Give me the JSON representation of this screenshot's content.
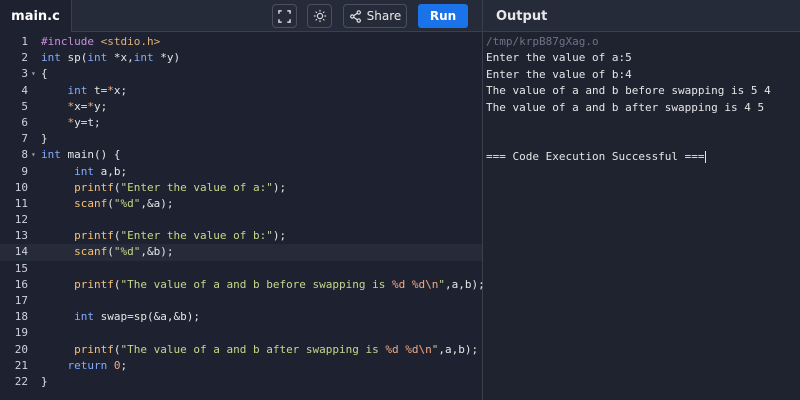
{
  "editor": {
    "file_tab": "main.c",
    "share_label": "Share",
    "run_label": "Run",
    "lines": [
      {
        "num": "1",
        "fold": ""
      },
      {
        "num": "2",
        "fold": ""
      },
      {
        "num": "3",
        "fold": "▾"
      },
      {
        "num": "4",
        "fold": ""
      },
      {
        "num": "5",
        "fold": ""
      },
      {
        "num": "6",
        "fold": ""
      },
      {
        "num": "7",
        "fold": ""
      },
      {
        "num": "8",
        "fold": "▾"
      },
      {
        "num": "9",
        "fold": ""
      },
      {
        "num": "10",
        "fold": ""
      },
      {
        "num": "11",
        "fold": ""
      },
      {
        "num": "12",
        "fold": ""
      },
      {
        "num": "13",
        "fold": ""
      },
      {
        "num": "14",
        "fold": ""
      },
      {
        "num": "15",
        "fold": ""
      },
      {
        "num": "16",
        "fold": ""
      },
      {
        "num": "17",
        "fold": ""
      },
      {
        "num": "18",
        "fold": ""
      },
      {
        "num": "19",
        "fold": ""
      },
      {
        "num": "20",
        "fold": ""
      },
      {
        "num": "21",
        "fold": ""
      },
      {
        "num": "22",
        "fold": ""
      }
    ],
    "code": {
      "l1_a": "#include",
      "l1_b": "<stdio.h>",
      "l2_a": "int",
      "l2_b": " sp(",
      "l2_c": "int",
      "l2_d": " *x,",
      "l2_e": "int",
      "l2_f": " *y)",
      "l3": "{",
      "l4_a": "    ",
      "l4_b": "int",
      "l4_c": " t=",
      "l4_d": "*",
      "l4_e": "x;",
      "l5_a": "    ",
      "l5_b": "*",
      "l5_c": "x=",
      "l5_d": "*",
      "l5_e": "y;",
      "l6_a": "    ",
      "l6_b": "*",
      "l6_c": "y=t;",
      "l7": "}",
      "l8_a": "int",
      "l8_b": " main() {",
      "l9_a": "     ",
      "l9_b": "int",
      "l9_c": " a,b;",
      "l10_a": "    ",
      "l10_b": "printf",
      "l10_c": "(",
      "l10_d": "\"Enter the value of a:\"",
      "l10_e": ");",
      "l11_a": "    ",
      "l11_b": "scanf",
      "l11_c": "(",
      "l11_d": "\"%d\"",
      "l11_e": ",&a);",
      "l12": "",
      "l13_a": "    ",
      "l13_b": "printf",
      "l13_c": "(",
      "l13_d": "\"Enter the value of b:\"",
      "l13_e": ");",
      "l14_a": "    ",
      "l14_b": "scanf",
      "l14_c": "(",
      "l14_d": "\"%d\"",
      "l14_e": ",&b);",
      "l15": "",
      "l16_a": "    ",
      "l16_b": "printf",
      "l16_c": "(",
      "l16_d": "\"The value of a and b before swapping is ",
      "l16_e": "%d %d\\n",
      "l16_f": "\"",
      "l16_g": ",a,b);",
      "l17": "",
      "l18_a": "     ",
      "l18_b": "int",
      "l18_c": " swap=sp(&a,&b);",
      "l19": "",
      "l20_a": "    ",
      "l20_b": "printf",
      "l20_c": "(",
      "l20_d": "\"The value of a and b after swapping is ",
      "l20_e": "%d %d\\n",
      "l20_f": "\"",
      "l20_g": ",a,b);",
      "l21_a": "   ",
      "l21_b": "return",
      "l21_c": " ",
      "l21_d": "0",
      "l21_e": ";",
      "l22": "}"
    }
  },
  "output": {
    "title": "Output",
    "lines": [
      "/tmp/krpB87gXag.o",
      "Enter the value of a:5",
      "Enter the value of b:4",
      "The value of a and b before swapping is 5 4",
      "The value of a and b after swapping is 4 5",
      "",
      "",
      "=== Code Execution Successful ==="
    ]
  },
  "icons": {
    "fullscreen": "fullscreen-icon",
    "theme": "sun-icon",
    "share": "share-icon"
  },
  "colors": {
    "run_button": "#1a73e8",
    "background": "#1e2230"
  }
}
